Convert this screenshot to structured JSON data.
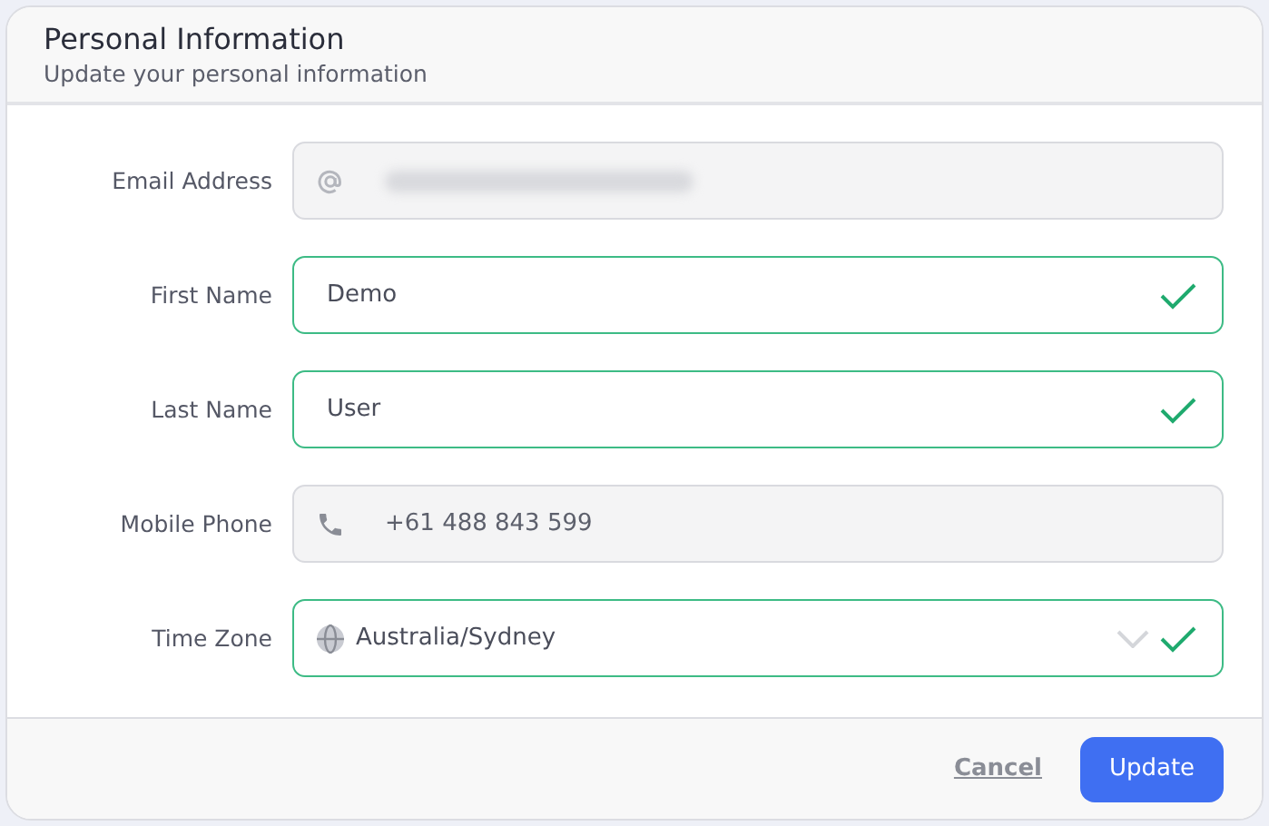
{
  "header": {
    "title": "Personal Information",
    "subtitle": "Update your personal information"
  },
  "fields": [
    {
      "label": "Email Address",
      "kind": "email",
      "blurred": true,
      "valid": false,
      "disabled": true
    },
    {
      "label": "First Name",
      "kind": "text",
      "value": "Demo",
      "valid": true,
      "disabled": false
    },
    {
      "label": "Last Name",
      "kind": "text",
      "value": "User",
      "valid": true,
      "disabled": false
    },
    {
      "label": "Mobile Phone",
      "kind": "phone",
      "value": "+61 488 843 599",
      "valid": false,
      "disabled": true
    },
    {
      "label": "Time Zone",
      "kind": "select",
      "value": "Australia/Sydney",
      "valid": true,
      "disabled": false
    }
  ],
  "footer": {
    "cancel": "Cancel",
    "submit": "Update"
  }
}
